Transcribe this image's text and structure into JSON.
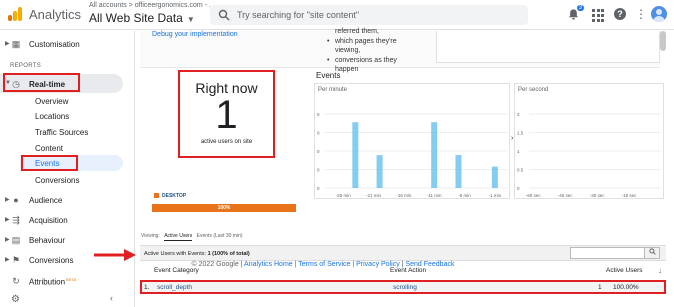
{
  "topbar": {
    "app_name": "Analytics",
    "accounts_breadcrumb": "All accounts > officeergonomics.com - ...",
    "property_name": "All Web Site Data",
    "search_placeholder": "Try searching for \"site content\"",
    "notification_count": "3"
  },
  "sidebar": {
    "customisation": "Customisation",
    "reports_label": "REPORTS",
    "realtime": "Real-time",
    "realtime_sub": [
      "Overview",
      "Locations",
      "Traffic Sources",
      "Content",
      "Events",
      "Conversions"
    ],
    "audience": "Audience",
    "acquisition": "Acquisition",
    "behaviour": "Behaviour",
    "conversions": "Conversions",
    "attribution": "Attribution",
    "attribution_badge": "BETA"
  },
  "top_panel": {
    "debug_link": "Debug your implementation",
    "bullets": [
      "referred them,",
      "which pages they're",
      "viewing,",
      "conversions as they",
      "happen"
    ]
  },
  "right_now": {
    "title": "Right now",
    "value": "1",
    "subtitle": "active users on site",
    "device_label": "DESKTOP",
    "device_percent": "100%"
  },
  "events": {
    "title": "Events",
    "per_minute_label": "Per minute",
    "per_second_label": "Per second"
  },
  "chart_data": [
    {
      "type": "bar",
      "title": "Per minute",
      "y_ticks": [
        "0",
        "0",
        "0",
        "0",
        "0"
      ],
      "x_ticks": [
        "-26 min",
        "-21 min",
        "-16 min",
        "-11 min",
        "-6 min",
        "-1 min"
      ],
      "bars": [
        {
          "x": -24,
          "value": 4
        },
        {
          "x": -20,
          "value": 2
        },
        {
          "x": -11,
          "value": 4
        },
        {
          "x": -7,
          "value": 2
        },
        {
          "x": -1,
          "value": 1.3
        }
      ],
      "series_color": "#6fc3f0"
    },
    {
      "type": "bar",
      "title": "Per second",
      "y_ticks": [
        "2",
        "1.5",
        "1",
        "0.5",
        "0"
      ],
      "x_ticks": [
        "-60 sec",
        "-45 sec",
        "-30 sec",
        "-15 sec"
      ],
      "values": []
    }
  ],
  "table": {
    "viewing_label": "Viewing:",
    "tab_active": "Active Users",
    "tab_inactive": "Events (Last 30 min)",
    "summary_prefix": "Active Users with Events: ",
    "summary_value": "1 (100% of total)",
    "columns": [
      "Event Category",
      "Event Action",
      "Active Users"
    ],
    "rows": [
      {
        "index": "1.",
        "category": "scroll_depth",
        "action": "scrolling",
        "users": "1",
        "percent": "100.00%"
      }
    ]
  },
  "footer": {
    "copyright": "© 2022 Google |",
    "links": [
      "Analytics Home",
      "Terms of Service",
      "Privacy Policy",
      "Send Feedback"
    ]
  },
  "colors": {
    "highlight": "#e02020",
    "device_bar": "#e8731a",
    "chart_bar": "#6fc3f0",
    "link": "#1a73e8"
  }
}
